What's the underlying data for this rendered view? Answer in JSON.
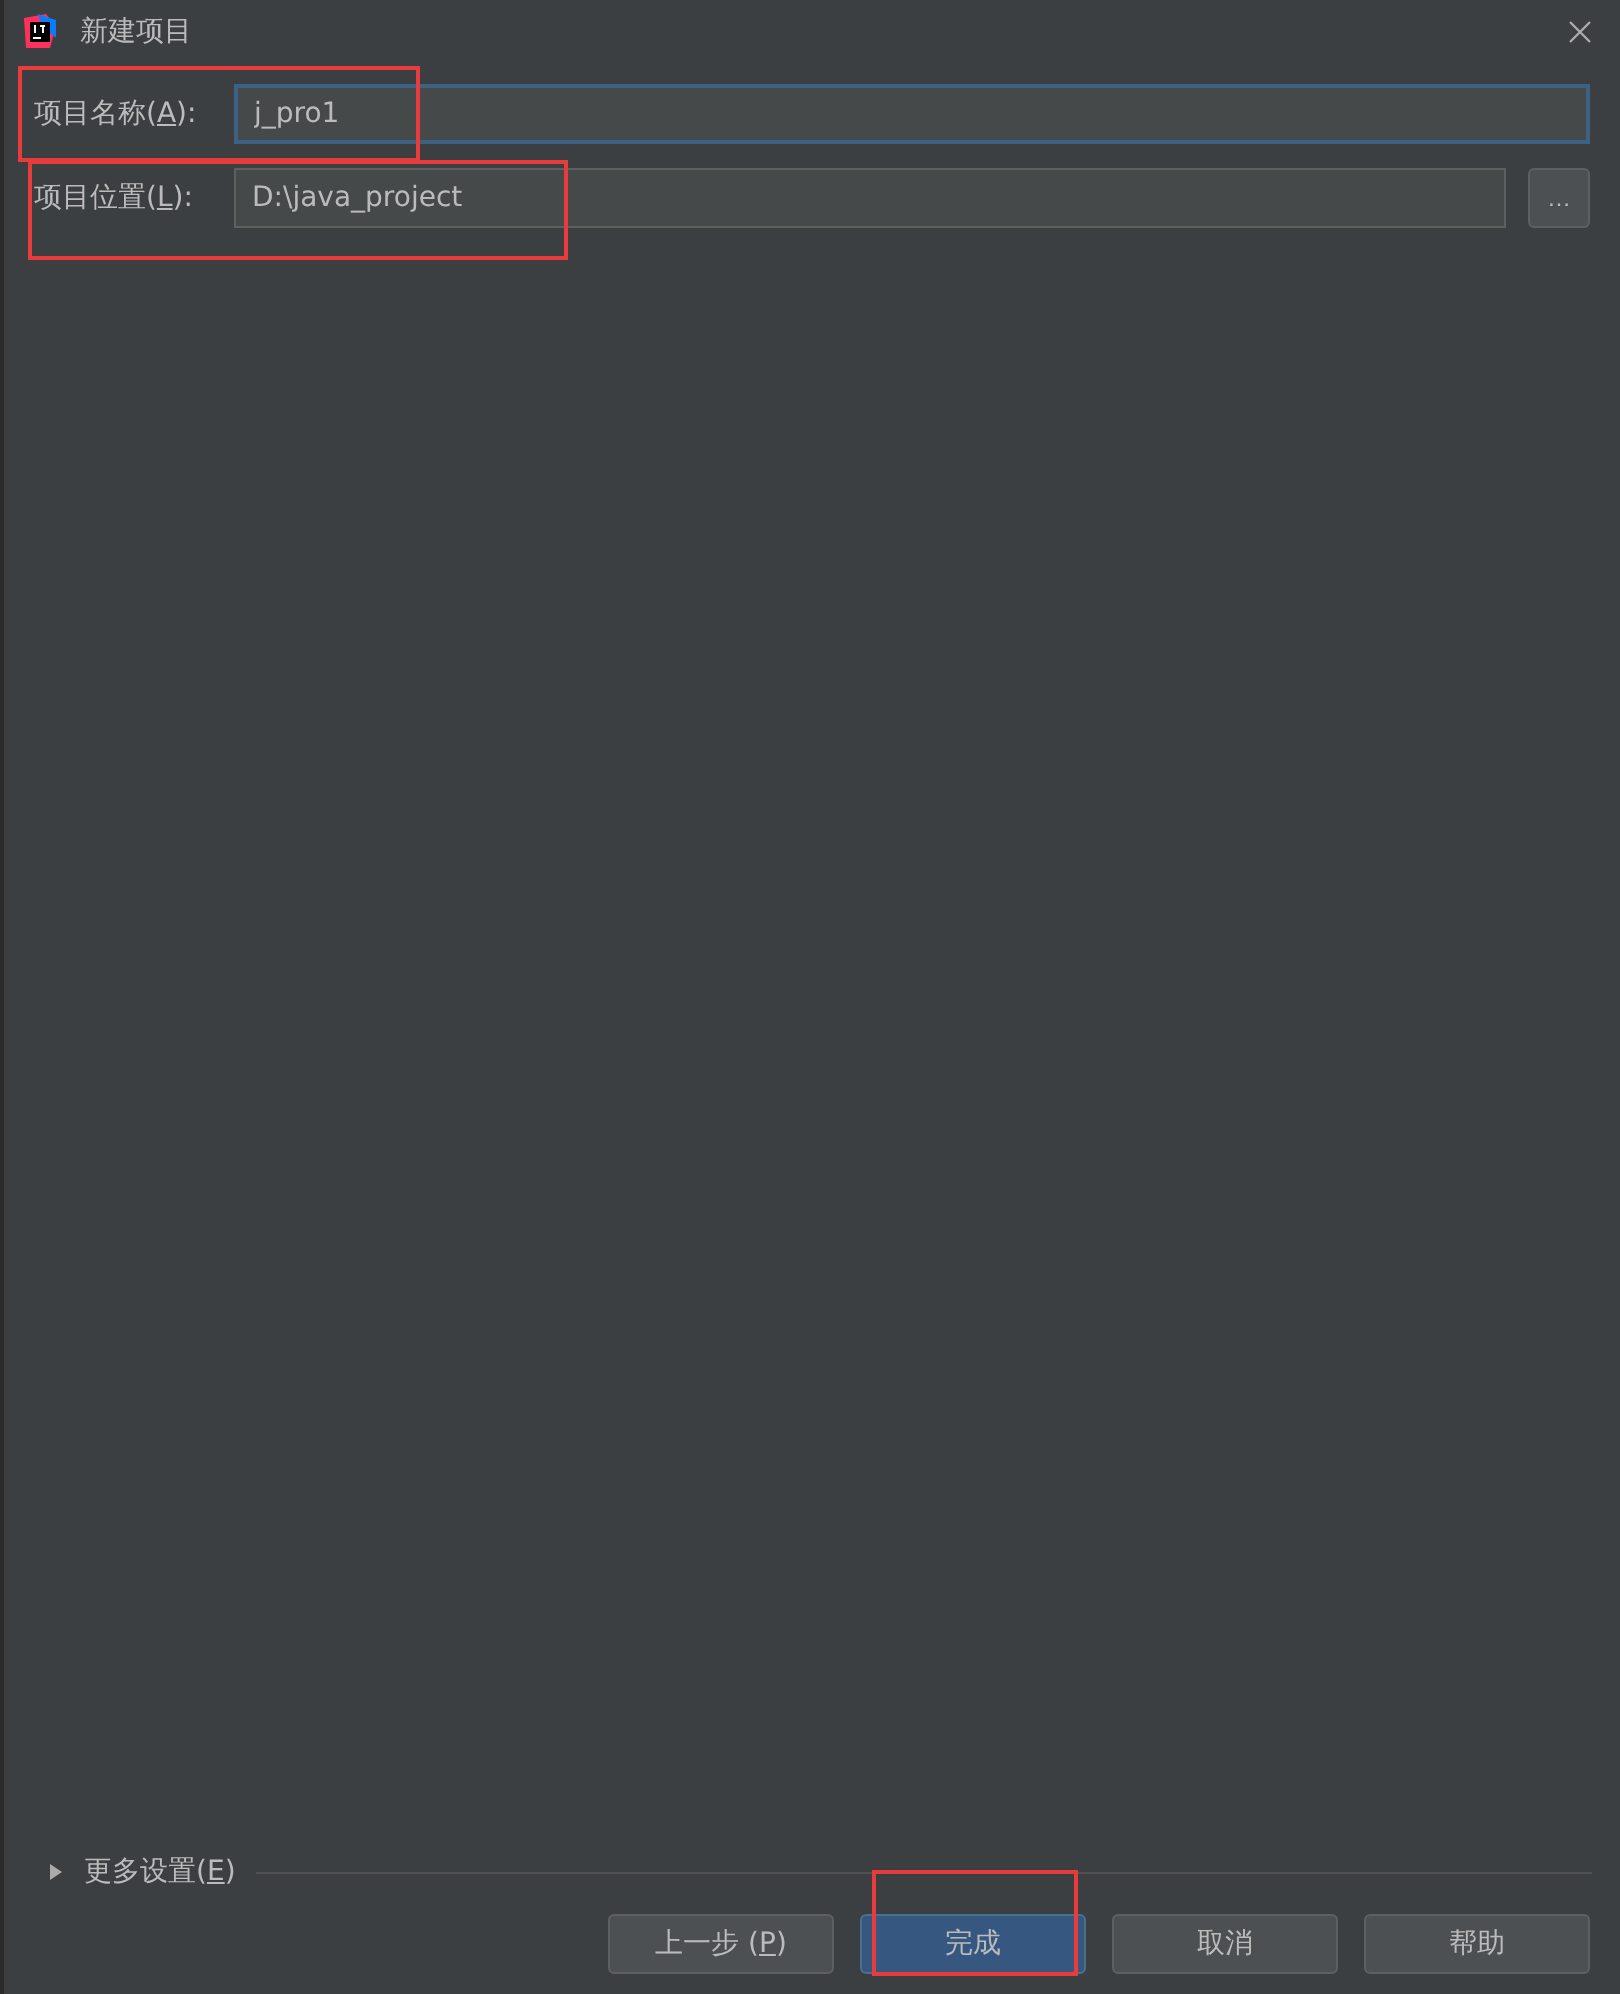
{
  "window": {
    "title": "新建项目"
  },
  "fields": [
    {
      "label_before": "项目名称(",
      "mnemonic": "A",
      "label_after": "):",
      "value": "j_pro1",
      "focused": true,
      "annotated": true
    },
    {
      "label_before": "项目位置(",
      "mnemonic": "L",
      "label_after": "):",
      "value": "D:\\java_project",
      "focused": false,
      "browse": "…",
      "annotated": true
    }
  ],
  "more_settings": {
    "label_before": "更多设置(",
    "mnemonic": "E",
    "label_after": ")",
    "expanded": false
  },
  "buttons": [
    {
      "label_before": "上一步 (",
      "mnemonic": "P",
      "label_after": ")",
      "default": false,
      "annotated": false
    },
    {
      "label_before": "完成",
      "default": true,
      "annotated": true
    },
    {
      "label_before": "取消",
      "default": false,
      "annotated": false
    },
    {
      "label_before": "帮助",
      "default": false,
      "annotated": false
    }
  ]
}
